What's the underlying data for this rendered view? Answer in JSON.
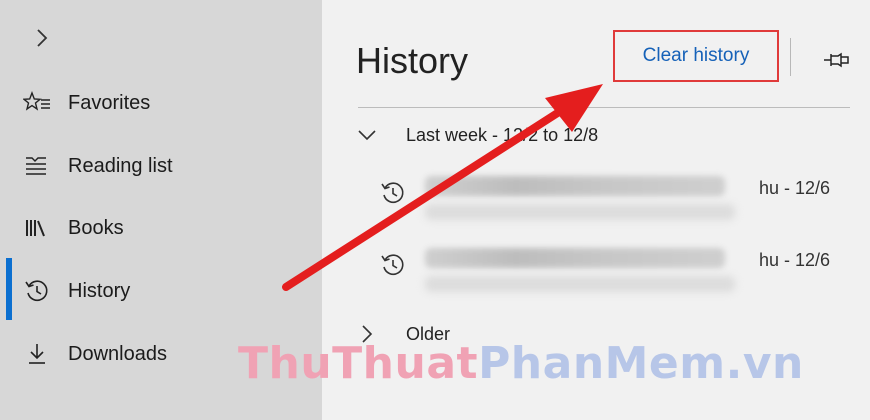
{
  "sidebar": {
    "items": [
      {
        "label": "Favorites",
        "icon": "favorites-star-icon"
      },
      {
        "label": "Reading list",
        "icon": "reading-list-icon"
      },
      {
        "label": "Books",
        "icon": "books-icon"
      },
      {
        "label": "History",
        "icon": "history-icon",
        "active": true
      },
      {
        "label": "Downloads",
        "icon": "downloads-icon"
      }
    ]
  },
  "panel": {
    "title": "History",
    "clear_button": "Clear history",
    "groups": [
      {
        "label": "Last week - 12/2 to 12/8",
        "expanded": true
      },
      {
        "label": "Older",
        "expanded": false
      }
    ],
    "entries": [
      {
        "date": "hu - 12/6"
      },
      {
        "date": "hu - 12/6"
      }
    ]
  },
  "watermark": {
    "part1": "ThuThuat",
    "part2": "PhanMem.vn"
  },
  "colors": {
    "accent": "#0b6fd0",
    "highlight_border": "#e03a3a",
    "arrow": "#e41e1e",
    "link": "#1561b8"
  }
}
